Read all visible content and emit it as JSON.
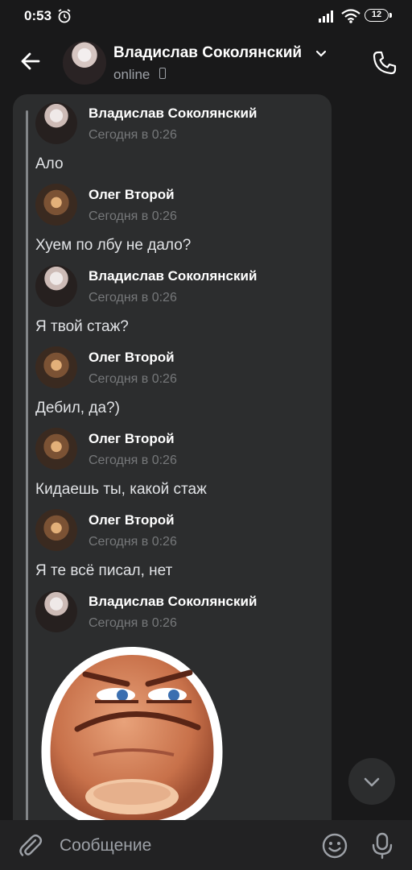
{
  "status_bar": {
    "time": "0:53",
    "battery": "12"
  },
  "header": {
    "name": "Владислав Соколянский",
    "status": "online"
  },
  "messages": [
    {
      "sender": "Владислав Соколянский",
      "time": "Сегодня в 0:26",
      "text": "Ало"
    },
    {
      "sender": "Олег Второй",
      "time": "Сегодня в 0:26",
      "text": "Хуем по лбу не дало?"
    },
    {
      "sender": "Владислав Соколянский",
      "time": "Сегодня в 0:26",
      "text": "Я твой стаж?"
    },
    {
      "sender": "Олег Второй",
      "time": "Сегодня в 0:26",
      "text": "Дебил, да?)"
    },
    {
      "sender": "Олег Второй",
      "time": "Сегодня в 0:26",
      "text": "Кидаешь ты, какой стаж"
    },
    {
      "sender": "Олег Второй",
      "time": "Сегодня в 0:26",
      "text": "Я те всё писал, нет"
    },
    {
      "sender": "Владислав Соколянский",
      "time": "Сегодня в 0:26",
      "text": ""
    }
  ],
  "composer": {
    "placeholder": "Сообщение"
  },
  "icons": {
    "back": "arrow-left-icon",
    "call": "phone-icon",
    "scroll_down": "chevron-down-icon",
    "attach": "paperclip-icon",
    "emoji": "smiley-icon",
    "mic": "microphone-icon"
  },
  "colors": {
    "background": "#19191a",
    "bubble": "#2c2d2e",
    "composer": "#222223",
    "text_primary": "#ffffff",
    "text_secondary": "#76787a"
  }
}
